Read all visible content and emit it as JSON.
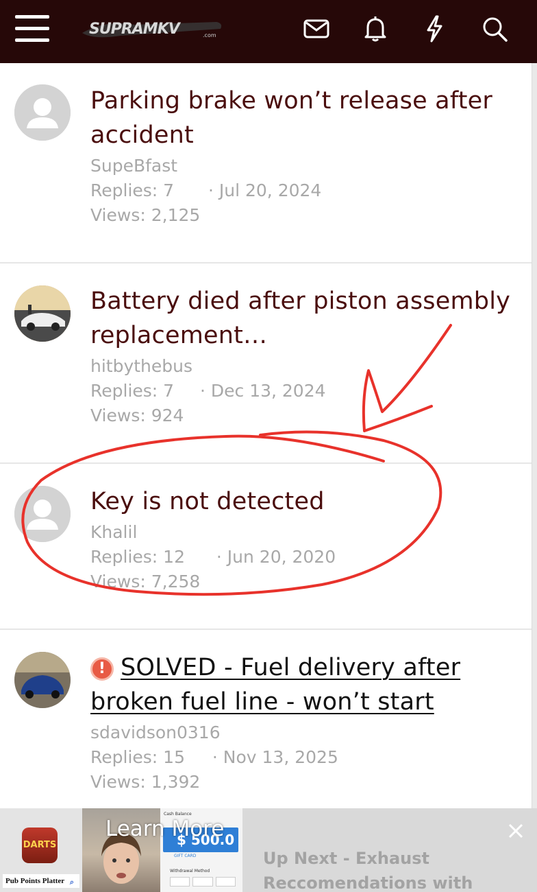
{
  "header": {
    "logo_text": "SUPRAMKV",
    "logo_suffix": ".com",
    "icons": [
      "menu-icon",
      "envelope-icon",
      "bell-icon",
      "lightning-icon",
      "search-icon"
    ],
    "bg_color": "#260808"
  },
  "threads": [
    {
      "title": "Parking brake won’t release after accident",
      "author": "SupeBfast",
      "replies": "Replies: 7",
      "date": "· Jul 20, 2024",
      "views": "Views: 2,125",
      "avatar": "default-avatar"
    },
    {
      "title": "Battery died after piston assembly replacement…",
      "author": "hitbythebus",
      "replies": "Replies: 7",
      "date": "· Dec 13, 2024",
      "views": "Views: 924",
      "avatar": "white-car-avatar"
    },
    {
      "title": "Key is not detected",
      "author": "Khalil",
      "replies": "Replies: 12",
      "date": "· Jun 20, 2020",
      "views": "Views: 7,258",
      "avatar": "default-avatar"
    },
    {
      "title": "SOLVED - Fuel delivery after broken fuel line - won’t start",
      "author": "sdavidson0316",
      "replies": "Replies: 15",
      "date": "· Nov 13, 2025",
      "views": "Views: 1,392",
      "avatar": "blue-car-avatar",
      "badge": "!"
    }
  ],
  "ad": {
    "app_icon_text": "DARTS",
    "app_label": "Pub Points Platter",
    "learn_more": "Learn More",
    "card_top": "Cash Balance",
    "card_amount": "$ 500.0",
    "card_subtitle": "GIFT CARD",
    "card_method": "Withdrawal Method",
    "up_next": "Up Next - Exhaust Reccomendations with"
  },
  "colors": {
    "title": "#4a0d0d",
    "meta": "#a8a8a8",
    "annotation": "#e8322b"
  }
}
